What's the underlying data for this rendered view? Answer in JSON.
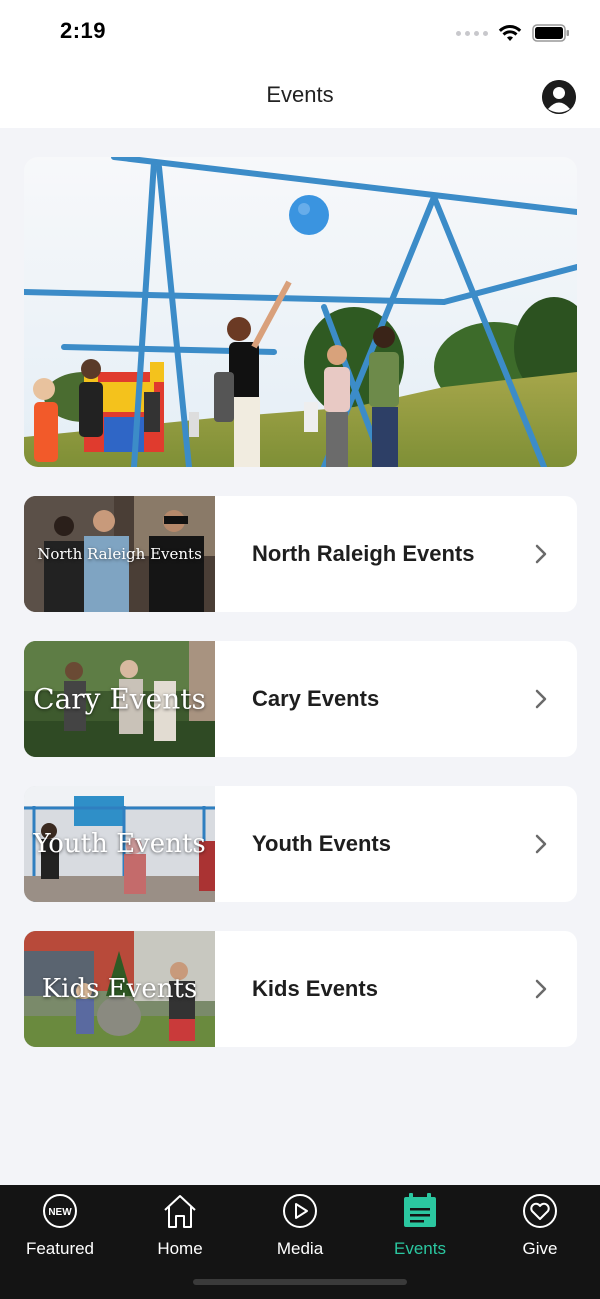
{
  "status_bar": {
    "time": "2:19"
  },
  "nav": {
    "title": "Events"
  },
  "events": [
    {
      "label": "North Raleigh Events",
      "thumb_text": "North Raleigh Events"
    },
    {
      "label": "Cary Events",
      "thumb_text": "Cary Events"
    },
    {
      "label": "Youth Events",
      "thumb_text": "Youth Events"
    },
    {
      "label": "Kids Events",
      "thumb_text": "Kids Events"
    }
  ],
  "tabs": [
    {
      "label": "Featured",
      "icon": "new-badge-icon"
    },
    {
      "label": "Home",
      "icon": "home-icon"
    },
    {
      "label": "Media",
      "icon": "play-icon"
    },
    {
      "label": "Events",
      "icon": "calendar-icon"
    },
    {
      "label": "Give",
      "icon": "heart-icon"
    }
  ],
  "tab_badge": {
    "text": "NEW"
  },
  "colors": {
    "accent": "#2bc7a0",
    "tab_bar_bg": "#141414",
    "page_bg": "#f3f4f8"
  }
}
